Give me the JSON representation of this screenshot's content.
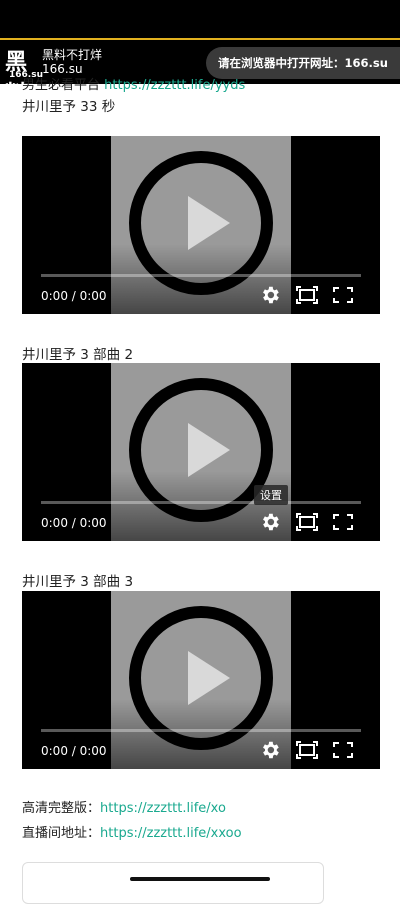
{
  "header": {
    "logo_big": "黑料",
    "logo_small": "166.su",
    "brand_title": "黑料不打烊",
    "brand_domain": "166.su",
    "open_in_browser": "请在浏览器中打开网址：166.su",
    "accent": "#e2b21f"
  },
  "partial_line": {
    "prefix": "男生必看平台",
    "link": "https://zzzttt.life/yyds"
  },
  "videos": [
    {
      "caption": "井川里予 33 秒",
      "time": "0:00 / 0:00"
    },
    {
      "caption": "井川里予 3 部曲 2",
      "time": "0:00 / 0:00"
    },
    {
      "caption": "井川里予 3 部曲 3",
      "time": "0:00 / 0:00"
    }
  ],
  "tooltip": "设置",
  "links": {
    "hd_label": "高清完整版：",
    "hd_url": "https://zzzttt.life/xo",
    "live_label": "直播间地址：",
    "live_url": "https://zzzttt.life/xxoo",
    "link_color": "#1aa98f"
  }
}
